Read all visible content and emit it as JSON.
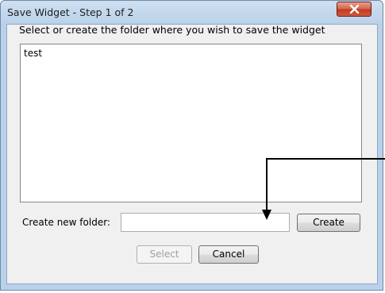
{
  "window": {
    "title": "Save Widget - Step 1 of 2",
    "close_icon": "close-icon"
  },
  "dialog": {
    "instruction": "Select or create the folder where you wish to save the widget",
    "folders": [
      "test"
    ],
    "new_folder_label": "Create new folder:",
    "new_folder_value": "",
    "create_label": "Create",
    "select_label": "Select",
    "cancel_label": "Cancel"
  },
  "colors": {
    "frame": "#b9d1ea",
    "close_button": "#c23b1f",
    "dialog_background": "#f0f0f0",
    "disabled_text": "#a0a0a0"
  }
}
